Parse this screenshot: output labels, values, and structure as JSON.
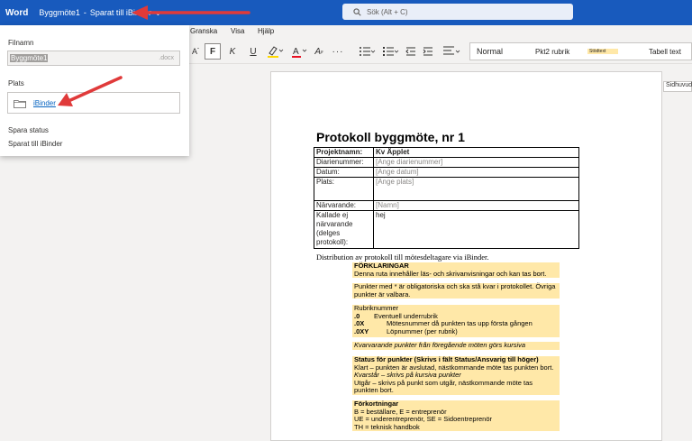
{
  "titlebar": {
    "app_name": "Word",
    "doc_name": "Byggmöte1",
    "separator": "-",
    "save_status": "Sparat till iBinder",
    "search_placeholder": "Sök (Alt + C)"
  },
  "ribbon": {
    "tabs": [
      "Granska",
      "Visa",
      "Hjälp"
    ],
    "bold_label": "F",
    "italic_label": "K",
    "underline_label": "U",
    "styles": [
      "Normal",
      "Pkt2 rubrik",
      "Stödtext",
      "Tabell text"
    ]
  },
  "panel": {
    "filename_label": "Filnamn",
    "filename_value": "Byggmöte1",
    "filename_ext": ".docx",
    "location_label": "Plats",
    "location_value": "iBinder",
    "save_status_label": "Spara status",
    "save_status_value": "Sparat till iBinder"
  },
  "doc": {
    "sidhuvud": "Sidhuvud",
    "heading": "Protokoll byggmöte, nr 1",
    "table": [
      {
        "label": "Projektnamn:",
        "value": "Kv Äpplet",
        "placeholder": false,
        "bold": true
      },
      {
        "label": "Diarienummer:",
        "value": "[Ange diarienummer]",
        "placeholder": true
      },
      {
        "label": "Datum:",
        "value": "[Ange datum]",
        "placeholder": true
      },
      {
        "label": "Plats:",
        "value": "[Ange plats]",
        "placeholder": true
      },
      {
        "label": "Närvarande:",
        "value": "[Namn]",
        "placeholder": true
      },
      {
        "label": "Kallade ej närvarande (delges protokoll):",
        "value": "hej",
        "placeholder": false
      }
    ],
    "distribution": "Distribution av protokoll till mötesdeltagare via iBinder.",
    "notes": {
      "n1_title": "FÖRKLARINGAR",
      "n1_text": "Denna ruta innehåller läs- och skrivanvisningar och kan tas bort.",
      "n2_text": "Punkter med * är obligatoriska och ska stå kvar i protokollet. Övriga punkter är valbara.",
      "n3_title": "Rubriknummer",
      "n3_rows": [
        {
          "k": ".0",
          "v": "Eventuell underrubrik"
        },
        {
          "k": ".0X",
          "v": "Mötesnummer då punkten tas upp första gången"
        },
        {
          "k": ".0XY",
          "v": "Löpnummer (per rubrik)"
        }
      ],
      "n4_text": "Kvarvarande punkter från föregående möten görs kursiva",
      "n5_title": "Status för punkter (Skrivs i fält Status/Ansvarig till höger)",
      "n5_l1": "Klart – punkten är avslutad, nästkommande möte tas punkten bort.",
      "n5_l2": "Kvarstår – skrivs på kursiva punkter",
      "n5_l3": "Utgår – skrivs på punkt som utgår, nästkommande möte tas punkten bort.",
      "n6_title": "Förkortningar",
      "n6_l1": "B = beställare, E = entreprenör",
      "n6_l2": "UE = underentreprenör, SE = Sidoentreprenör",
      "n6_l3": "TH = teknisk handbok"
    }
  },
  "colors": {
    "titlebar": "#185abd",
    "highlight_note": "#ffe8a8",
    "arrow": "#e03a3a",
    "link": "#0563c1"
  }
}
